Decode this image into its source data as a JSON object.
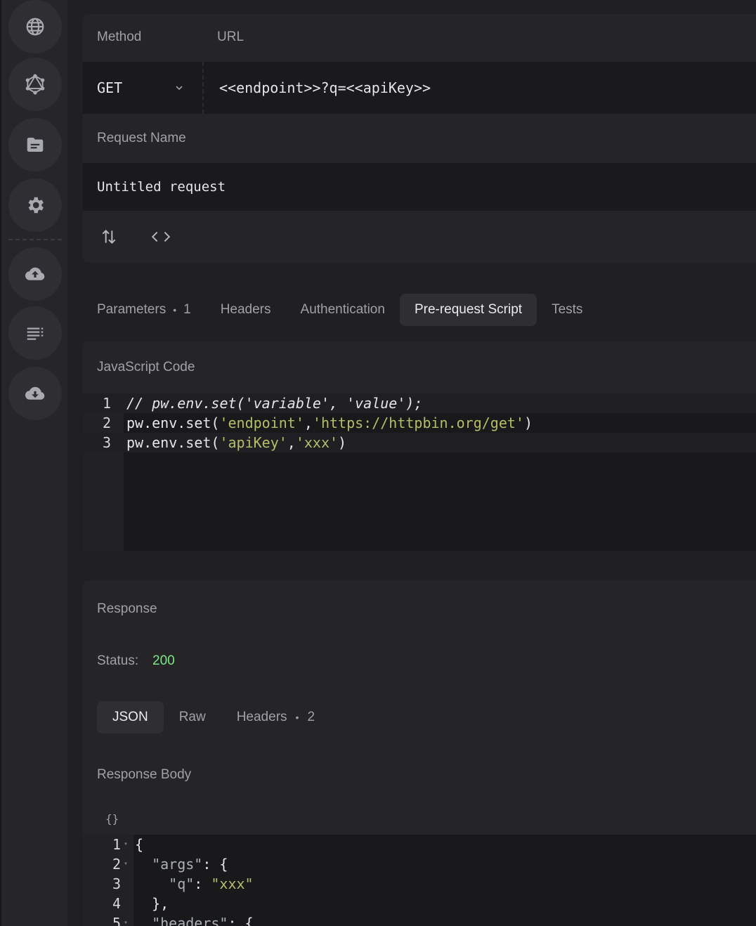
{
  "request": {
    "method_label": "Method",
    "url_label": "URL",
    "method_value": "GET",
    "url_value": "<<endpoint>>?q=<<apiKey>>",
    "name_label": "Request Name",
    "name_value": "Untitled request"
  },
  "tabs": [
    {
      "label": "Parameters",
      "count": "1"
    },
    {
      "label": "Headers"
    },
    {
      "label": "Authentication"
    },
    {
      "label": "Pre-request Script",
      "active": true
    },
    {
      "label": "Tests"
    }
  ],
  "script": {
    "title": "JavaScript Code",
    "lines": [
      {
        "n": "1",
        "comment": "// pw.env.set('variable', 'value');"
      },
      {
        "n": "2",
        "pre": "pw.env.set(",
        "a": "'endpoint'",
        "mid": ",",
        "b": "'https://httpbin.org/get'",
        "post": ")"
      },
      {
        "n": "3",
        "pre": "pw.env.set(",
        "a": "'apiKey'",
        "mid": ",",
        "b": "'xxx'",
        "post": ")"
      }
    ]
  },
  "response": {
    "title": "Response",
    "status_label": "Status:",
    "status_value": "200",
    "status_color": "#7ee787",
    "subtabs": [
      {
        "label": "JSON",
        "active": true
      },
      {
        "label": "Raw"
      },
      {
        "label": "Headers",
        "count": "2"
      }
    ],
    "body_title": "Response Body",
    "body_icon_text": "{}",
    "body_lines": [
      {
        "n": "1",
        "text": "{"
      },
      {
        "n": "2",
        "key": "  \"args\"",
        "rest": ": {"
      },
      {
        "n": "3",
        "key": "    \"q\"",
        "sep": ": ",
        "str": "\"xxx\""
      },
      {
        "n": "4",
        "text": "  },"
      },
      {
        "n": "5",
        "key": "  \"headers\"",
        "rest": ": {"
      }
    ]
  },
  "icons": {
    "nav": [
      "globe-icon",
      "graphql-icon",
      "collections-icon",
      "settings-icon",
      "cloud-upload-icon",
      "logs-icon",
      "cloud-download-icon"
    ],
    "toolbar": [
      "transfer-icon",
      "code-icon"
    ]
  }
}
